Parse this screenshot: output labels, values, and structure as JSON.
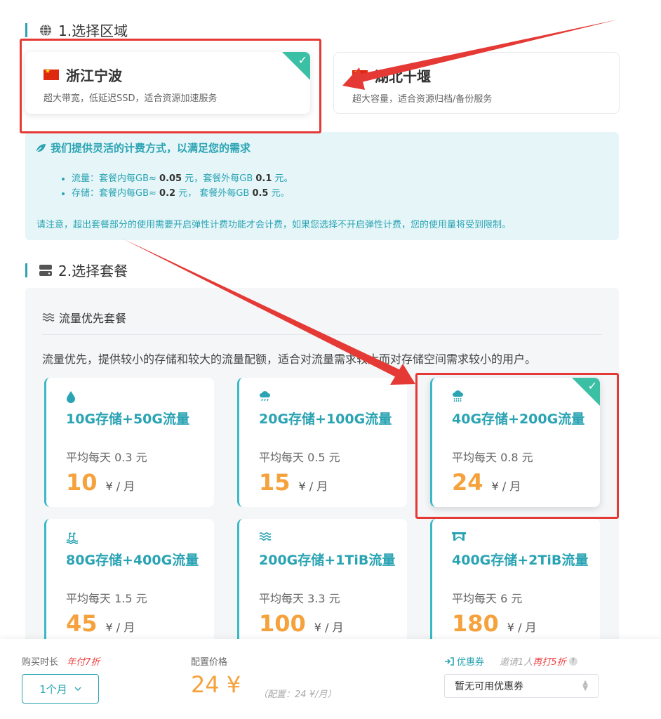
{
  "section1": {
    "title": "1.选择区域"
  },
  "regions": [
    {
      "name": "浙江宁波",
      "desc": "超大带宽，低延迟SSD，适合资源加速服务"
    },
    {
      "name": "湖北十堰",
      "desc": "超大容量，适合资源归档/备份服务"
    }
  ],
  "info": {
    "title": "我们提供灵活的计费方式，以满足您的需求",
    "traffic": {
      "label": "流量：套餐内每GB≈ ",
      "in_price": "0.05",
      "mid": " 元，套餐外每GB ",
      "out_price": "0.1",
      "end": " 元。"
    },
    "storage": {
      "label": "存储：套餐内每GB≈ ",
      "in_price": "0.2",
      "mid": " 元， 套餐外每GB ",
      "out_price": "0.5",
      "end": " 元。"
    },
    "note": "请注意，超出套餐部分的使用需要开启弹性计费功能才会计费，如果您选择不开启弹性计费，您的使用量将受到限制。"
  },
  "section2": {
    "title": "2.选择套餐"
  },
  "package_group": {
    "title": "流量优先套餐",
    "desc": "流量优先，提供较小的存储和较大的流量配额，适合对流量需求较大而对存储空间需求较小的用户。"
  },
  "packages": [
    {
      "icon": "droplet-icon",
      "title": "10G存储+50G流量",
      "avg": "平均每天 0.3 元",
      "price": "10",
      "unit": "¥ / 月"
    },
    {
      "icon": "cloud-rain-icon",
      "title": "20G存储+100G流量",
      "avg": "平均每天 0.5 元",
      "price": "15",
      "unit": "¥ / 月"
    },
    {
      "icon": "cloud-heavy-rain-icon",
      "title": "40G存储+200G流量",
      "avg": "平均每天 0.8 元",
      "price": "24",
      "unit": "¥ / 月"
    },
    {
      "icon": "pool-icon",
      "title": "80G存储+400G流量",
      "avg": "平均每天 1.5 元",
      "price": "45",
      "unit": "¥ / 月"
    },
    {
      "icon": "water-icon",
      "title": "200G存储+1TiB流量",
      "avg": "平均每天 3.3 元",
      "price": "100",
      "unit": "¥ / 月"
    },
    {
      "icon": "bridge-icon",
      "title": "400G存储+2TiB流量",
      "avg": "平均每天 6 元",
      "price": "180",
      "unit": "¥ / 月"
    }
  ],
  "footer": {
    "duration_label": "购买时长",
    "duration_promo": "年付7折",
    "duration_value": "1个月",
    "price_label": "配置价格",
    "price_value": "24 ¥",
    "price_note": "（配置：24 ¥/月）",
    "coupon_label": "优惠券",
    "coupon_promo_a": "邀请1人",
    "coupon_promo_b": "再打5折",
    "coupon_value": "暂无可用优惠券"
  },
  "colors": {
    "accent": "#2aa3b3",
    "price": "#f5a23d",
    "highlight": "#e53935",
    "check": "#3cc0a5"
  }
}
